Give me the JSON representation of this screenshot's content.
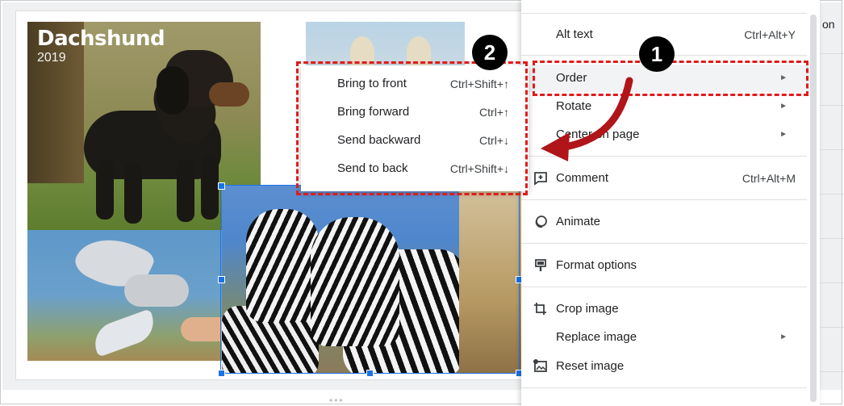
{
  "slide": {
    "dachshund_title": "Dachshund",
    "dachshund_year": "2019"
  },
  "context_menu": {
    "items": [
      {
        "label": "Alt text",
        "shortcut": "Ctrl+Alt+Y"
      },
      {
        "label": "Order",
        "submenu": true
      },
      {
        "label": "Rotate",
        "submenu": true
      },
      {
        "label": "Center on page",
        "submenu": true
      },
      {
        "label": "Comment",
        "shortcut": "Ctrl+Alt+M",
        "icon": "comment-add-icon"
      },
      {
        "label": "Animate",
        "icon": "animate-icon"
      },
      {
        "label": "Format options",
        "icon": "format-options-icon"
      },
      {
        "label": "Crop image",
        "icon": "crop-icon"
      },
      {
        "label": "Replace image",
        "submenu": true
      },
      {
        "label": "Reset image",
        "icon": "reset-image-icon"
      }
    ],
    "submenu_arrow": "►"
  },
  "order_submenu": {
    "items": [
      {
        "label": "Bring to front",
        "shortcut": "Ctrl+Shift+↑"
      },
      {
        "label": "Bring forward",
        "shortcut": "Ctrl+↑"
      },
      {
        "label": "Send backward",
        "shortcut": "Ctrl+↓"
      },
      {
        "label": "Send to back",
        "shortcut": "Ctrl+Shift+↓"
      }
    ]
  },
  "annotations": {
    "badge_1": "1",
    "badge_2": "2",
    "highlight_color": "#e01b1b"
  },
  "edge_text": "on"
}
